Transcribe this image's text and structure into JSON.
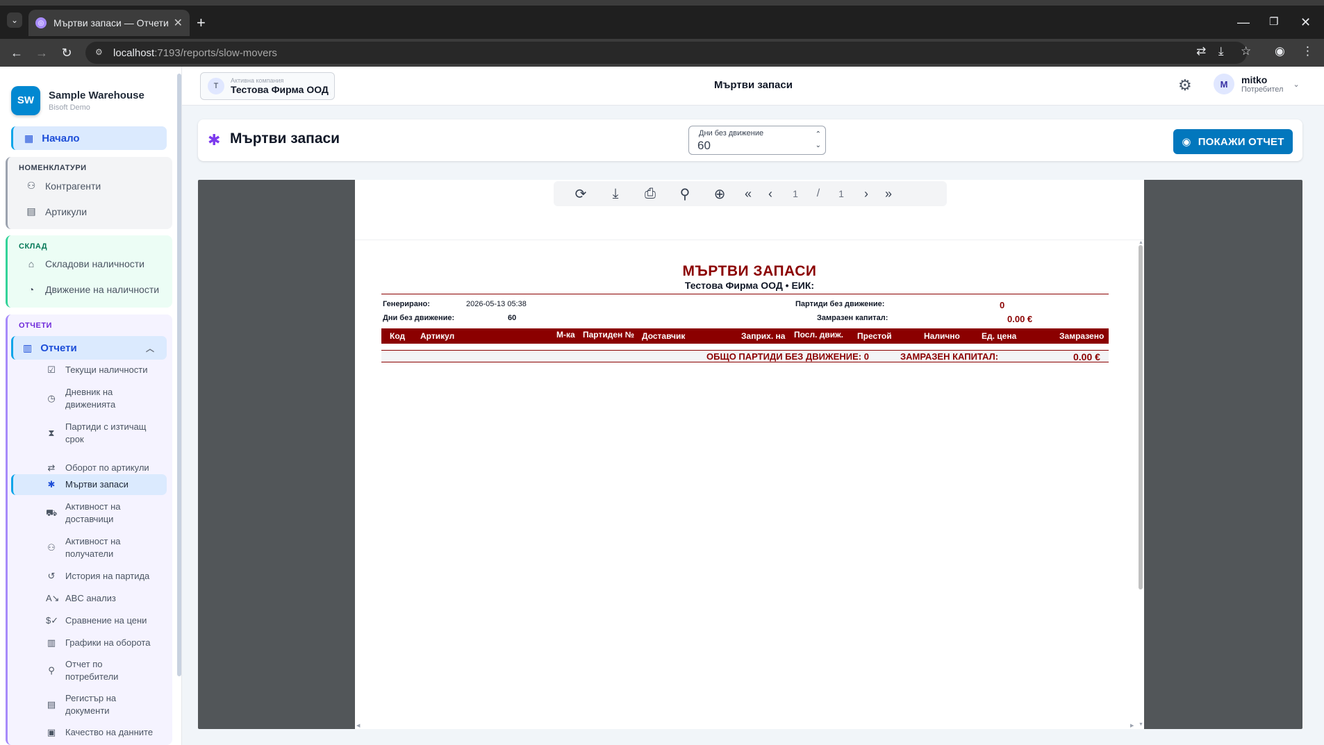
{
  "browser": {
    "tab_title": "Мъртви запаси — Отчети",
    "url_host": "localhost",
    "url_path": ":7193/reports/slow-movers"
  },
  "sidebar": {
    "brand_initials": "SW",
    "brand_name": "Sample Warehouse",
    "brand_sub": "Bisoft Demo",
    "home": "Начало",
    "groups": {
      "nomenclatures": {
        "title": "НОМЕНКЛАТУРИ",
        "items": [
          "Контрагенти",
          "Артикули"
        ]
      },
      "warehouse": {
        "title": "СКЛАД",
        "items": [
          "Складови наличности",
          "Движение на наличности"
        ]
      },
      "reports": {
        "title": "ОТЧЕТИ",
        "header": "Отчети"
      }
    },
    "report_items": [
      "Текущи наличности",
      "Дневник на движенията",
      "Партиди с изтичащ срок",
      "Оборот по артикули",
      "Мъртви запаси",
      "Активност на доставчици",
      "Активност на получатели",
      "История на партида",
      "ABC анализ",
      "Сравнение на цени",
      "Графики на оборота",
      "Отчет по потребители",
      "Регистър на документи",
      "Качество на данните"
    ]
  },
  "topbar": {
    "company_initial": "Т",
    "company_caption": "Активна компания",
    "company_name": "Тестова Фирма ООД",
    "title": "Мъртви запаси",
    "user_initial": "M",
    "user_name": "mitko",
    "user_role": "Потребител"
  },
  "report_card": {
    "title": "Мъртви запаси",
    "days_label": "Дни без движение",
    "days_value": "60",
    "show_button": "ПОКАЖИ ОТЧЕТ"
  },
  "viewer": {
    "page_current": "1",
    "page_sep": "/",
    "page_total": "1"
  },
  "report": {
    "title": "МЪРТВИ ЗАПАСИ",
    "subtitle": "Тестова Фирма ООД • ЕИК:",
    "generated_label": "Генерирано:",
    "generated_value": "2026-05-13 05:38",
    "days_label": "Дни без движение:",
    "days_value": "60",
    "batches_label": "Партиди без движение:",
    "batches_value": "0",
    "frozen_label": "Замразен капитал:",
    "frozen_value": "0.00 €",
    "columns": [
      "Код",
      "Артикул",
      "М-ка",
      "Партиден №",
      "Доставчик",
      "Заприх. на",
      "Посл. движ.",
      "Престой",
      "Налично",
      "Ед. цена",
      "Замразено"
    ],
    "footer_batches": "ОБЩО ПАРТИДИ БЕЗ ДВИЖЕНИЕ: 0",
    "footer_frozen_label": "ЗАМРАЗЕН КАПИТАЛ:",
    "footer_frozen_value": "0.00 €"
  }
}
